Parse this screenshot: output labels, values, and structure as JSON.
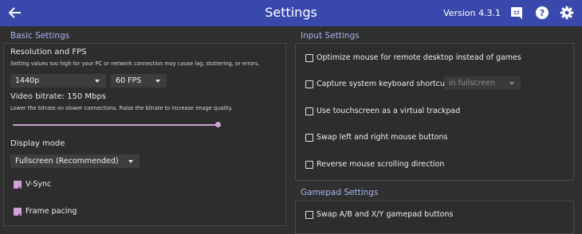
{
  "header": {
    "title": "Settings",
    "version": "Version 4.3.1",
    "icons": {
      "back": "arrow-left-icon",
      "discord": "discord-icon",
      "help": "help-icon",
      "settings": "gear-icon"
    },
    "bar_color": "#3949ab"
  },
  "basic": {
    "section_title": "Basic Settings",
    "resolution": {
      "heading": "Resolution and FPS",
      "note": "Setting values too high for your PC or network connection may cause lag, stuttering, or errors.",
      "resolution_value": "1440p",
      "fps_value": "60 FPS"
    },
    "bitrate": {
      "heading": "Video bitrate: 150 Mbps",
      "note": "Lower the bitrate on slower connections. Raise the bitrate to increase image quality.",
      "slider_level": 1.0
    },
    "display": {
      "heading": "Display mode",
      "value": "Fullscreen (Recommended)"
    },
    "vsync": {
      "label": "V-Sync",
      "checked": true
    },
    "frame_pacing": {
      "label": "Frame pacing",
      "checked": true
    }
  },
  "input": {
    "section_title": "Input Settings",
    "items": [
      {
        "label": "Optimize mouse for remote desktop instead of games",
        "checked": false
      },
      {
        "label": "Capture system keyboard shortcuts",
        "checked": false,
        "dropdown": "in fullscreen"
      },
      {
        "label": "Use touchscreen as a virtual trackpad",
        "checked": false
      },
      {
        "label": "Swap left and right mouse buttons",
        "checked": false
      },
      {
        "label": "Reverse mouse scrolling direction",
        "checked": false
      }
    ]
  },
  "gamepad": {
    "section_title": "Gamepad Settings",
    "items": [
      {
        "label": "Swap A/B and X/Y gamepad buttons",
        "checked": false
      }
    ]
  },
  "colors": {
    "accent": "#d4a0dc",
    "section_title": "#a7b4ee",
    "background": "#303030"
  }
}
